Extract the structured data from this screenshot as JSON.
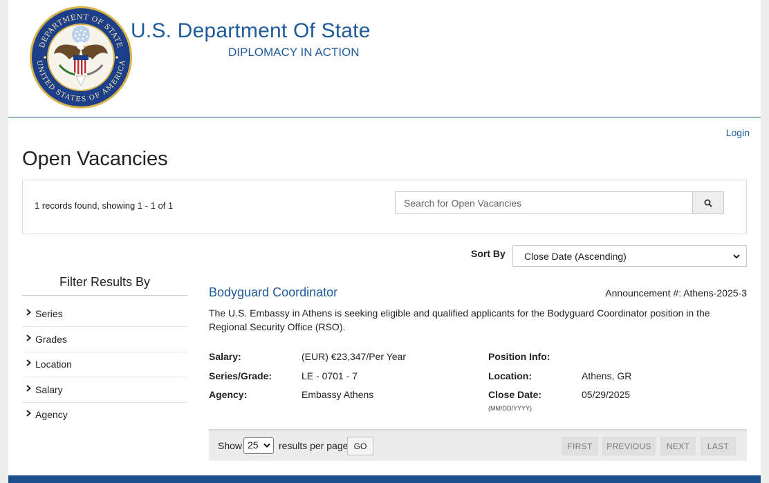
{
  "header": {
    "title": "U.S. Department Of State",
    "subtitle": "DIPLOMACY IN ACTION",
    "seal_icon": "department-of-state-seal",
    "seal_text_top": "DEPARTMENT OF STATE",
    "seal_text_bottom": "UNITED STATES OF AMERICA"
  },
  "nav": {
    "login_label": "Login"
  },
  "page_title": "Open Vacancies",
  "search": {
    "records_text": "1 records found, showing 1 - 1 of 1",
    "placeholder": "Search for Open Vacancies",
    "button_icon": "search-icon"
  },
  "sort": {
    "label": "Sort By",
    "selected": "Close Date (Ascending)"
  },
  "filters": {
    "title": "Filter Results By",
    "items": [
      {
        "label": "Series"
      },
      {
        "label": "Grades"
      },
      {
        "label": "Location"
      },
      {
        "label": "Salary"
      },
      {
        "label": "Agency"
      }
    ]
  },
  "job": {
    "title": "Bodyguard Coordinator",
    "announcement": "Announcement #: Athens-2025-3",
    "description": "The U.S. Embassy in Athens is seeking eligible and qualified applicants for the Bodyguard Coordinator position in the Regional Security Office (RSO).",
    "salary_label": "Salary:",
    "salary_value": "(EUR) €23,347/Per Year",
    "series_label": "Series/Grade:",
    "series_value": "LE - 0701 - 7",
    "agency_label": "Agency:",
    "agency_value": "Embassy Athens",
    "position_label": "Position Info:",
    "location_label": "Location:",
    "location_value": "Athens, GR",
    "close_label": "Close Date:",
    "close_value": "05/29/2025",
    "date_format": "(MM/DD/YYYY)"
  },
  "pagination": {
    "show_label": "Show",
    "per_page": "25",
    "results_label": "results per page",
    "go_label": "GO",
    "first": "FIRST",
    "previous": "PREVIOUS",
    "next": "NEXT",
    "last": "LAST"
  },
  "colors": {
    "brand_blue": "#1f5a9a",
    "footer_blue": "#1c4f8d"
  }
}
